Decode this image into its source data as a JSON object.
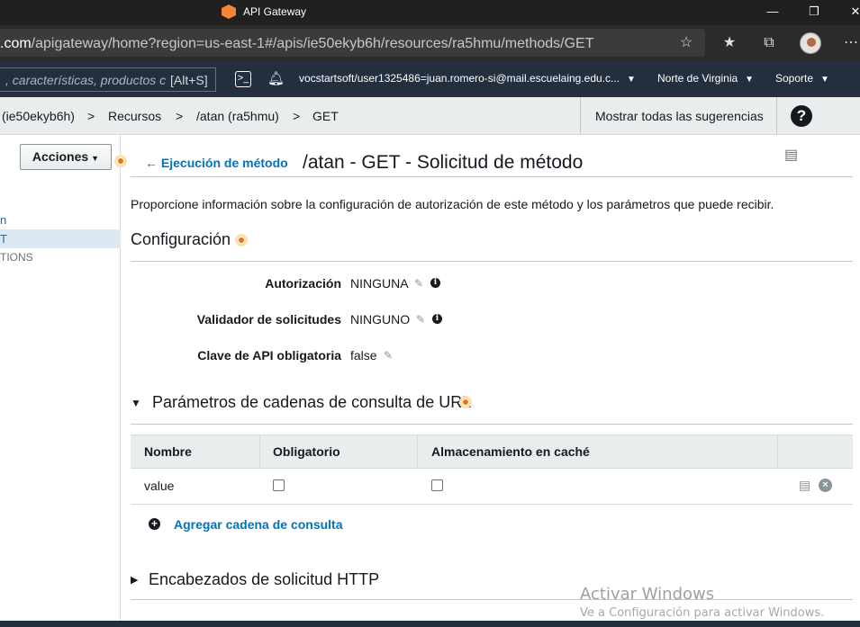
{
  "window": {
    "title": "API Gateway",
    "controls": [
      "—",
      "❐",
      "✕"
    ]
  },
  "address_bar": {
    "url_domain": ".com",
    "url_path": "/apigateway/home?region=us-east-1#/apis/ie50ekyb6h/resources/ra5hmu/methods/GET"
  },
  "aws_nav": {
    "search_placeholder": ", características, productos c",
    "search_shortcut": "[Alt+S]",
    "account": "vocstartsoft/user1325486=juan.romero-si@mail.escuelaing.edu.c...",
    "region": "Norte de Virginia",
    "support": "Soporte"
  },
  "breadcrumb": {
    "items": [
      "(ie50ekyb6h)",
      ">",
      "Recursos",
      ">",
      "/atan (ra5hmu)",
      ">",
      "GET"
    ],
    "suggestions": "Mostrar todas las sugerencias",
    "help": "?"
  },
  "left_panel": {
    "actions_label": "Acciones",
    "tree": [
      "n",
      "T",
      "TIONS"
    ]
  },
  "main": {
    "back_link": "Ejecución de método",
    "title": "/atan - GET - Solicitud de método",
    "description": "Proporcione información sobre la configuración de autorización de este método y los parámetros que puede recibir.",
    "config_heading": "Configuración",
    "fields": [
      {
        "label": "Autorización",
        "value": "NINGUNA"
      },
      {
        "label": "Validador de solicitudes",
        "value": "NINGUNO"
      },
      {
        "label": "Clave de API obligatoria",
        "value": "false"
      }
    ],
    "query_section": "Parámetros de cadenas de consulta de URL",
    "table_headers": [
      "Nombre",
      "Obligatorio",
      "Almacenamiento en caché"
    ],
    "table_rows": [
      {
        "name": "value",
        "required": false,
        "caching": false
      }
    ],
    "add_query": "Agregar cadena de consulta",
    "headers_section": "Encabezados de solicitud HTTP"
  },
  "watermark": {
    "line1": "Activar Windows",
    "line2": "Ve a Configuración para activar Windows."
  }
}
